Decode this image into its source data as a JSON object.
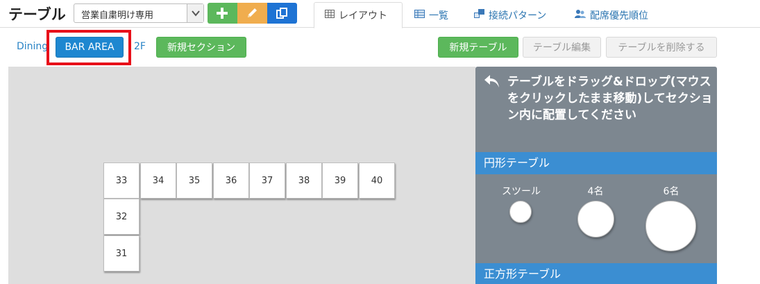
{
  "header": {
    "title": "テーブル",
    "select_value": "営業自粛明け専用",
    "tabs": [
      {
        "label": "レイアウト",
        "icon": "grid-icon"
      },
      {
        "label": "一覧",
        "icon": "table-list-icon"
      },
      {
        "label": "接続パターン",
        "icon": "connection-icon"
      },
      {
        "label": "配席優先順位",
        "icon": "priority-icon"
      }
    ]
  },
  "toolbar": {
    "sections": [
      "Dining",
      "BAR AREA",
      "2F"
    ],
    "new_section": "新規セクション",
    "new_table": "新規テーブル",
    "edit_table": "テーブル編集",
    "delete_table": "テーブルを削除する"
  },
  "canvas": {
    "tables": [
      "33",
      "34",
      "35",
      "36",
      "37",
      "38",
      "39",
      "40",
      "32",
      "31"
    ]
  },
  "panel": {
    "instruction": "テーブルをドラッグ&ドロップ(マウスをクリックしたまま移動)してセクション内に配置してください",
    "round_section": "円形テーブル",
    "round_shapes": [
      "スツール",
      "4名",
      "6名"
    ],
    "square_section": "正方形テーブル"
  },
  "colors": {
    "primary": "#1e87d0",
    "success": "#5cb85c",
    "warning": "#f0ad4e",
    "highlight": "#e8101a",
    "panel": "#7d8790",
    "section_bar": "#3b8ed2"
  }
}
